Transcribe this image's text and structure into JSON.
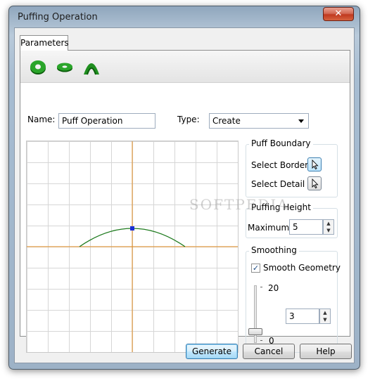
{
  "window": {
    "title": "Puffing Operation",
    "close_glyph": "✕"
  },
  "tabs": [
    {
      "label": "Parameters"
    }
  ],
  "toolbar": {
    "icons": [
      "torus-puff-icon",
      "disc-puff-icon",
      "arch-puff-icon"
    ]
  },
  "form": {
    "name_label": "Name:",
    "name_value": "Puff Operation",
    "type_label": "Type:",
    "type_value": "Create"
  },
  "puff_boundary": {
    "title": "Puff Boundary",
    "select_borders_label": "Select Borders",
    "select_detail_label": "Select Detail"
  },
  "puffing_height": {
    "title": "Puffing Height",
    "maximum_label": "Maximum",
    "maximum_value": "5"
  },
  "smoothing": {
    "title": "Smoothing",
    "smooth_geometry_label": "Smooth Geometry",
    "smooth_geometry_checked": true,
    "slider_max_label": "20",
    "slider_min_label": "0",
    "slider_value": "3",
    "slider_level": 0.0
  },
  "buttons": {
    "generate": "Generate",
    "cancel": "Cancel",
    "help": "Help"
  },
  "watermark": "SOFTPEDIA",
  "colors": {
    "curve": "#1d7a1d",
    "axis": "#e08a1e",
    "control_point": "#1a2fd6"
  }
}
